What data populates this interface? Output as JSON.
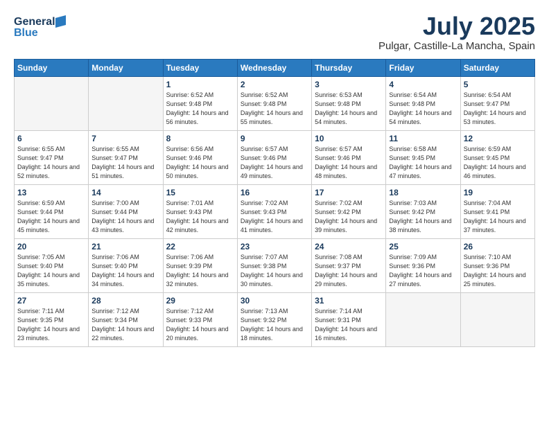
{
  "header": {
    "logo_line1": "General",
    "logo_line2": "Blue",
    "month": "July 2025",
    "location": "Pulgar, Castille-La Mancha, Spain"
  },
  "weekdays": [
    "Sunday",
    "Monday",
    "Tuesday",
    "Wednesday",
    "Thursday",
    "Friday",
    "Saturday"
  ],
  "weeks": [
    [
      {
        "day": "",
        "empty": true
      },
      {
        "day": "",
        "empty": true
      },
      {
        "day": "1",
        "sunrise": "6:52 AM",
        "sunset": "9:48 PM",
        "daylight": "14 hours and 56 minutes."
      },
      {
        "day": "2",
        "sunrise": "6:52 AM",
        "sunset": "9:48 PM",
        "daylight": "14 hours and 55 minutes."
      },
      {
        "day": "3",
        "sunrise": "6:53 AM",
        "sunset": "9:48 PM",
        "daylight": "14 hours and 54 minutes."
      },
      {
        "day": "4",
        "sunrise": "6:54 AM",
        "sunset": "9:48 PM",
        "daylight": "14 hours and 54 minutes."
      },
      {
        "day": "5",
        "sunrise": "6:54 AM",
        "sunset": "9:47 PM",
        "daylight": "14 hours and 53 minutes."
      }
    ],
    [
      {
        "day": "6",
        "sunrise": "6:55 AM",
        "sunset": "9:47 PM",
        "daylight": "14 hours and 52 minutes."
      },
      {
        "day": "7",
        "sunrise": "6:55 AM",
        "sunset": "9:47 PM",
        "daylight": "14 hours and 51 minutes."
      },
      {
        "day": "8",
        "sunrise": "6:56 AM",
        "sunset": "9:46 PM",
        "daylight": "14 hours and 50 minutes."
      },
      {
        "day": "9",
        "sunrise": "6:57 AM",
        "sunset": "9:46 PM",
        "daylight": "14 hours and 49 minutes."
      },
      {
        "day": "10",
        "sunrise": "6:57 AM",
        "sunset": "9:46 PM",
        "daylight": "14 hours and 48 minutes."
      },
      {
        "day": "11",
        "sunrise": "6:58 AM",
        "sunset": "9:45 PM",
        "daylight": "14 hours and 47 minutes."
      },
      {
        "day": "12",
        "sunrise": "6:59 AM",
        "sunset": "9:45 PM",
        "daylight": "14 hours and 46 minutes."
      }
    ],
    [
      {
        "day": "13",
        "sunrise": "6:59 AM",
        "sunset": "9:44 PM",
        "daylight": "14 hours and 45 minutes."
      },
      {
        "day": "14",
        "sunrise": "7:00 AM",
        "sunset": "9:44 PM",
        "daylight": "14 hours and 43 minutes."
      },
      {
        "day": "15",
        "sunrise": "7:01 AM",
        "sunset": "9:43 PM",
        "daylight": "14 hours and 42 minutes."
      },
      {
        "day": "16",
        "sunrise": "7:02 AM",
        "sunset": "9:43 PM",
        "daylight": "14 hours and 41 minutes."
      },
      {
        "day": "17",
        "sunrise": "7:02 AM",
        "sunset": "9:42 PM",
        "daylight": "14 hours and 39 minutes."
      },
      {
        "day": "18",
        "sunrise": "7:03 AM",
        "sunset": "9:42 PM",
        "daylight": "14 hours and 38 minutes."
      },
      {
        "day": "19",
        "sunrise": "7:04 AM",
        "sunset": "9:41 PM",
        "daylight": "14 hours and 37 minutes."
      }
    ],
    [
      {
        "day": "20",
        "sunrise": "7:05 AM",
        "sunset": "9:40 PM",
        "daylight": "14 hours and 35 minutes."
      },
      {
        "day": "21",
        "sunrise": "7:06 AM",
        "sunset": "9:40 PM",
        "daylight": "14 hours and 34 minutes."
      },
      {
        "day": "22",
        "sunrise": "7:06 AM",
        "sunset": "9:39 PM",
        "daylight": "14 hours and 32 minutes."
      },
      {
        "day": "23",
        "sunrise": "7:07 AM",
        "sunset": "9:38 PM",
        "daylight": "14 hours and 30 minutes."
      },
      {
        "day": "24",
        "sunrise": "7:08 AM",
        "sunset": "9:37 PM",
        "daylight": "14 hours and 29 minutes."
      },
      {
        "day": "25",
        "sunrise": "7:09 AM",
        "sunset": "9:36 PM",
        "daylight": "14 hours and 27 minutes."
      },
      {
        "day": "26",
        "sunrise": "7:10 AM",
        "sunset": "9:36 PM",
        "daylight": "14 hours and 25 minutes."
      }
    ],
    [
      {
        "day": "27",
        "sunrise": "7:11 AM",
        "sunset": "9:35 PM",
        "daylight": "14 hours and 23 minutes."
      },
      {
        "day": "28",
        "sunrise": "7:12 AM",
        "sunset": "9:34 PM",
        "daylight": "14 hours and 22 minutes."
      },
      {
        "day": "29",
        "sunrise": "7:12 AM",
        "sunset": "9:33 PM",
        "daylight": "14 hours and 20 minutes."
      },
      {
        "day": "30",
        "sunrise": "7:13 AM",
        "sunset": "9:32 PM",
        "daylight": "14 hours and 18 minutes."
      },
      {
        "day": "31",
        "sunrise": "7:14 AM",
        "sunset": "9:31 PM",
        "daylight": "14 hours and 16 minutes."
      },
      {
        "day": "",
        "empty": true
      },
      {
        "day": "",
        "empty": true
      }
    ]
  ]
}
